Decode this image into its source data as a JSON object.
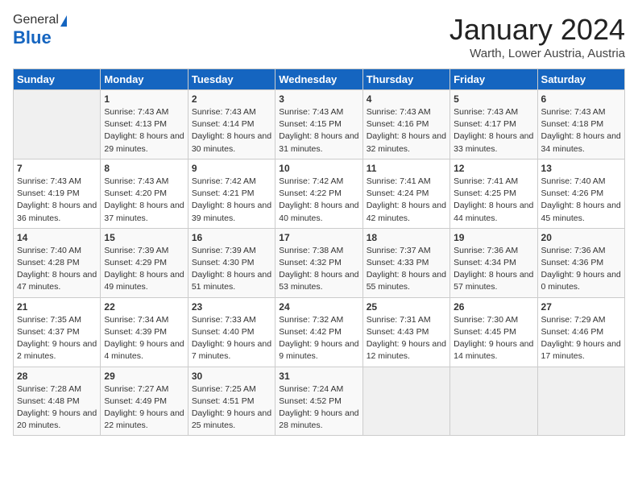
{
  "logo": {
    "general": "General",
    "blue": "Blue"
  },
  "header": {
    "month": "January 2024",
    "location": "Warth, Lower Austria, Austria"
  },
  "days_of_week": [
    "Sunday",
    "Monday",
    "Tuesday",
    "Wednesday",
    "Thursday",
    "Friday",
    "Saturday"
  ],
  "weeks": [
    [
      {
        "day": "",
        "empty": true
      },
      {
        "day": "1",
        "sunrise": "Sunrise: 7:43 AM",
        "sunset": "Sunset: 4:13 PM",
        "daylight": "Daylight: 8 hours and 29 minutes."
      },
      {
        "day": "2",
        "sunrise": "Sunrise: 7:43 AM",
        "sunset": "Sunset: 4:14 PM",
        "daylight": "Daylight: 8 hours and 30 minutes."
      },
      {
        "day": "3",
        "sunrise": "Sunrise: 7:43 AM",
        "sunset": "Sunset: 4:15 PM",
        "daylight": "Daylight: 8 hours and 31 minutes."
      },
      {
        "day": "4",
        "sunrise": "Sunrise: 7:43 AM",
        "sunset": "Sunset: 4:16 PM",
        "daylight": "Daylight: 8 hours and 32 minutes."
      },
      {
        "day": "5",
        "sunrise": "Sunrise: 7:43 AM",
        "sunset": "Sunset: 4:17 PM",
        "daylight": "Daylight: 8 hours and 33 minutes."
      },
      {
        "day": "6",
        "sunrise": "Sunrise: 7:43 AM",
        "sunset": "Sunset: 4:18 PM",
        "daylight": "Daylight: 8 hours and 34 minutes."
      }
    ],
    [
      {
        "day": "7",
        "sunrise": "Sunrise: 7:43 AM",
        "sunset": "Sunset: 4:19 PM",
        "daylight": "Daylight: 8 hours and 36 minutes."
      },
      {
        "day": "8",
        "sunrise": "Sunrise: 7:43 AM",
        "sunset": "Sunset: 4:20 PM",
        "daylight": "Daylight: 8 hours and 37 minutes."
      },
      {
        "day": "9",
        "sunrise": "Sunrise: 7:42 AM",
        "sunset": "Sunset: 4:21 PM",
        "daylight": "Daylight: 8 hours and 39 minutes."
      },
      {
        "day": "10",
        "sunrise": "Sunrise: 7:42 AM",
        "sunset": "Sunset: 4:22 PM",
        "daylight": "Daylight: 8 hours and 40 minutes."
      },
      {
        "day": "11",
        "sunrise": "Sunrise: 7:41 AM",
        "sunset": "Sunset: 4:24 PM",
        "daylight": "Daylight: 8 hours and 42 minutes."
      },
      {
        "day": "12",
        "sunrise": "Sunrise: 7:41 AM",
        "sunset": "Sunset: 4:25 PM",
        "daylight": "Daylight: 8 hours and 44 minutes."
      },
      {
        "day": "13",
        "sunrise": "Sunrise: 7:40 AM",
        "sunset": "Sunset: 4:26 PM",
        "daylight": "Daylight: 8 hours and 45 minutes."
      }
    ],
    [
      {
        "day": "14",
        "sunrise": "Sunrise: 7:40 AM",
        "sunset": "Sunset: 4:28 PM",
        "daylight": "Daylight: 8 hours and 47 minutes."
      },
      {
        "day": "15",
        "sunrise": "Sunrise: 7:39 AM",
        "sunset": "Sunset: 4:29 PM",
        "daylight": "Daylight: 8 hours and 49 minutes."
      },
      {
        "day": "16",
        "sunrise": "Sunrise: 7:39 AM",
        "sunset": "Sunset: 4:30 PM",
        "daylight": "Daylight: 8 hours and 51 minutes."
      },
      {
        "day": "17",
        "sunrise": "Sunrise: 7:38 AM",
        "sunset": "Sunset: 4:32 PM",
        "daylight": "Daylight: 8 hours and 53 minutes."
      },
      {
        "day": "18",
        "sunrise": "Sunrise: 7:37 AM",
        "sunset": "Sunset: 4:33 PM",
        "daylight": "Daylight: 8 hours and 55 minutes."
      },
      {
        "day": "19",
        "sunrise": "Sunrise: 7:36 AM",
        "sunset": "Sunset: 4:34 PM",
        "daylight": "Daylight: 8 hours and 57 minutes."
      },
      {
        "day": "20",
        "sunrise": "Sunrise: 7:36 AM",
        "sunset": "Sunset: 4:36 PM",
        "daylight": "Daylight: 9 hours and 0 minutes."
      }
    ],
    [
      {
        "day": "21",
        "sunrise": "Sunrise: 7:35 AM",
        "sunset": "Sunset: 4:37 PM",
        "daylight": "Daylight: 9 hours and 2 minutes."
      },
      {
        "day": "22",
        "sunrise": "Sunrise: 7:34 AM",
        "sunset": "Sunset: 4:39 PM",
        "daylight": "Daylight: 9 hours and 4 minutes."
      },
      {
        "day": "23",
        "sunrise": "Sunrise: 7:33 AM",
        "sunset": "Sunset: 4:40 PM",
        "daylight": "Daylight: 9 hours and 7 minutes."
      },
      {
        "day": "24",
        "sunrise": "Sunrise: 7:32 AM",
        "sunset": "Sunset: 4:42 PM",
        "daylight": "Daylight: 9 hours and 9 minutes."
      },
      {
        "day": "25",
        "sunrise": "Sunrise: 7:31 AM",
        "sunset": "Sunset: 4:43 PM",
        "daylight": "Daylight: 9 hours and 12 minutes."
      },
      {
        "day": "26",
        "sunrise": "Sunrise: 7:30 AM",
        "sunset": "Sunset: 4:45 PM",
        "daylight": "Daylight: 9 hours and 14 minutes."
      },
      {
        "day": "27",
        "sunrise": "Sunrise: 7:29 AM",
        "sunset": "Sunset: 4:46 PM",
        "daylight": "Daylight: 9 hours and 17 minutes."
      }
    ],
    [
      {
        "day": "28",
        "sunrise": "Sunrise: 7:28 AM",
        "sunset": "Sunset: 4:48 PM",
        "daylight": "Daylight: 9 hours and 20 minutes."
      },
      {
        "day": "29",
        "sunrise": "Sunrise: 7:27 AM",
        "sunset": "Sunset: 4:49 PM",
        "daylight": "Daylight: 9 hours and 22 minutes."
      },
      {
        "day": "30",
        "sunrise": "Sunrise: 7:25 AM",
        "sunset": "Sunset: 4:51 PM",
        "daylight": "Daylight: 9 hours and 25 minutes."
      },
      {
        "day": "31",
        "sunrise": "Sunrise: 7:24 AM",
        "sunset": "Sunset: 4:52 PM",
        "daylight": "Daylight: 9 hours and 28 minutes."
      },
      {
        "day": "",
        "empty": true
      },
      {
        "day": "",
        "empty": true
      },
      {
        "day": "",
        "empty": true
      }
    ]
  ]
}
